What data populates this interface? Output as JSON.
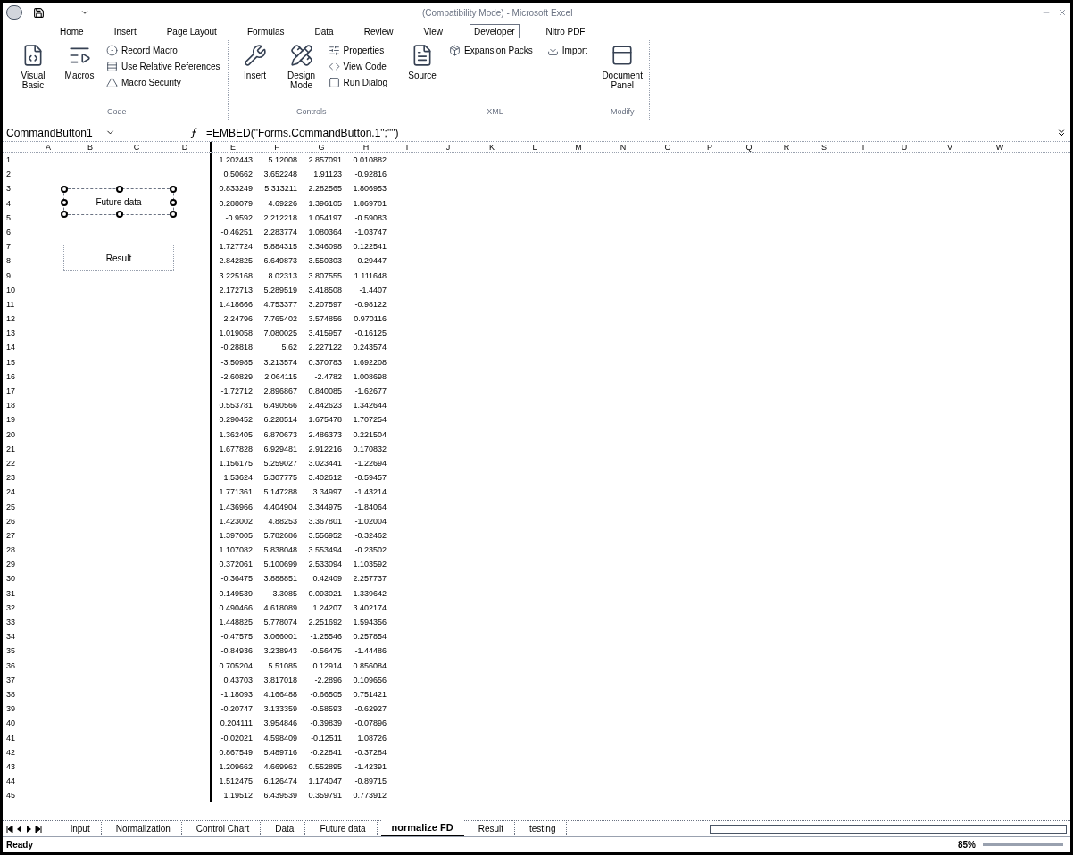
{
  "window": {
    "title": "(Compatibility Mode) - Microsoft Excel"
  },
  "ribbon_tabs": [
    {
      "label": "Home",
      "selected": false
    },
    {
      "label": "Insert",
      "selected": false
    },
    {
      "label": "Page Layout",
      "selected": false
    },
    {
      "label": "Formulas",
      "selected": false
    },
    {
      "label": "Data",
      "selected": false
    },
    {
      "label": "Review",
      "selected": false
    },
    {
      "label": "View",
      "selected": false
    },
    {
      "label": "Developer",
      "selected": true
    },
    {
      "label": "Nitro PDF",
      "selected": false
    }
  ],
  "ribbon_groups": [
    {
      "label": "Code",
      "large": [
        {
          "label": "Visual Basic"
        },
        {
          "label": "Macros"
        }
      ],
      "small": [
        {
          "label": "Record Macro"
        },
        {
          "label": "Use Relative References"
        },
        {
          "label": "Macro Security"
        }
      ]
    },
    {
      "label": "Controls",
      "large": [
        {
          "label": "Insert"
        },
        {
          "label": "Design Mode"
        }
      ],
      "small": [
        {
          "label": "Properties"
        },
        {
          "label": "View Code"
        },
        {
          "label": "Run Dialog"
        }
      ]
    },
    {
      "label": "XML",
      "large": [
        {
          "label": "Source"
        }
      ],
      "small": [
        {
          "label": "Expansion Packs"
        }
      ],
      "small2": [
        {
          "label": "Import"
        }
      ]
    },
    {
      "label": "Modify",
      "large": [
        {
          "label": "Document Panel"
        }
      ]
    }
  ],
  "name_box": "CommandButton1",
  "formula": "=EMBED(\"Forms.CommandButton.1\";\"\")",
  "columns": [
    "A",
    "B",
    "C",
    "D",
    "E",
    "F",
    "G",
    "H",
    "I",
    "J",
    "K",
    "L",
    "M",
    "N",
    "O",
    "P",
    "Q",
    "R",
    "S",
    "T",
    "U",
    "V",
    "W"
  ],
  "rows": [
    {
      "header": "1",
      "cells": [
        "1.202443",
        "5.12008",
        "2.857091",
        "0.010882"
      ]
    },
    {
      "header": "2",
      "cells": [
        "0.50662",
        "3.652248",
        "1.91123",
        "-0.92816"
      ]
    },
    {
      "header": "3",
      "cells": [
        "0.833249",
        "5.313211",
        "2.282565",
        "1.806953"
      ]
    },
    {
      "header": "4",
      "cells": [
        "0.288079",
        "4.69226",
        "1.396105",
        "1.869701"
      ]
    },
    {
      "header": "5",
      "cells": [
        "-0.9592",
        "2.212218",
        "1.054197",
        "-0.59083"
      ]
    },
    {
      "header": "6",
      "cells": [
        "-0.46251",
        "2.283774",
        "1.080364",
        "-1.03747"
      ]
    },
    {
      "header": "7",
      "cells": [
        "1.727724",
        "5.884315",
        "3.346098",
        "0.122541"
      ]
    },
    {
      "header": "8",
      "cells": [
        "2.842825",
        "6.649873",
        "3.550303",
        "-0.29447"
      ]
    },
    {
      "header": "9",
      "cells": [
        "3.225168",
        "8.02313",
        "3.807555",
        "1.111648"
      ]
    },
    {
      "header": "10",
      "cells": [
        "2.172713",
        "5.289519",
        "3.418508",
        "-1.4407"
      ]
    },
    {
      "header": "11",
      "cells": [
        "1.418666",
        "4.753377",
        "3.207597",
        "-0.98122"
      ]
    },
    {
      "header": "12",
      "cells": [
        "2.24796",
        "7.765402",
        "3.574856",
        "0.970116"
      ]
    },
    {
      "header": "13",
      "cells": [
        "1.019058",
        "7.080025",
        "3.415957",
        "-0.16125"
      ]
    },
    {
      "header": "14",
      "cells": [
        "-0.28818",
        "5.62",
        "2.227122",
        "0.243574"
      ]
    },
    {
      "header": "15",
      "cells": [
        "-3.50985",
        "3.213574",
        "0.370783",
        "1.692208"
      ]
    },
    {
      "header": "16",
      "cells": [
        "-2.60829",
        "2.064115",
        "-2.4782",
        "1.008698"
      ]
    },
    {
      "header": "17",
      "cells": [
        "-1.72712",
        "2.896867",
        "0.840085",
        "-1.62677"
      ]
    },
    {
      "header": "18",
      "cells": [
        "0.553781",
        "6.490566",
        "2.442623",
        "1.342644"
      ]
    },
    {
      "header": "19",
      "cells": [
        "0.290452",
        "6.228514",
        "1.675478",
        "1.707254"
      ]
    },
    {
      "header": "20",
      "cells": [
        "1.362405",
        "6.870673",
        "2.486373",
        "0.221504"
      ]
    },
    {
      "header": "21",
      "cells": [
        "1.677828",
        "6.929481",
        "2.912216",
        "0.170832"
      ]
    },
    {
      "header": "22",
      "cells": [
        "1.156175",
        "5.259027",
        "3.023441",
        "-1.22694"
      ]
    },
    {
      "header": "23",
      "cells": [
        "1.53624",
        "5.307775",
        "3.402612",
        "-0.59457"
      ]
    },
    {
      "header": "24",
      "cells": [
        "1.771361",
        "5.147288",
        "3.34997",
        "-1.43214"
      ]
    },
    {
      "header": "25",
      "cells": [
        "1.436966",
        "4.404904",
        "3.344975",
        "-1.84064"
      ]
    },
    {
      "header": "26",
      "cells": [
        "1.423002",
        "4.88253",
        "3.367801",
        "-1.02004"
      ]
    },
    {
      "header": "27",
      "cells": [
        "1.397005",
        "5.782686",
        "3.556952",
        "-0.32462"
      ]
    },
    {
      "header": "28",
      "cells": [
        "1.107082",
        "5.838048",
        "3.553494",
        "-0.23502"
      ]
    },
    {
      "header": "29",
      "cells": [
        "0.372061",
        "5.100699",
        "2.533094",
        "1.103592"
      ]
    },
    {
      "header": "30",
      "cells": [
        "-0.36475",
        "3.888851",
        "0.42409",
        "2.257737"
      ]
    },
    {
      "header": "31",
      "cells": [
        "0.149539",
        "3.3085",
        "0.093021",
        "1.339642"
      ]
    },
    {
      "header": "32",
      "cells": [
        "0.490466",
        "4.618089",
        "1.24207",
        "3.402174"
      ]
    },
    {
      "header": "33",
      "cells": [
        "1.448825",
        "5.778074",
        "2.251692",
        "1.594356"
      ]
    },
    {
      "header": "34",
      "cells": [
        "-0.47575",
        "3.066001",
        "-1.25546",
        "0.257854"
      ]
    },
    {
      "header": "35",
      "cells": [
        "-0.84936",
        "3.238943",
        "-0.56475",
        "-1.44486"
      ]
    },
    {
      "header": "36",
      "cells": [
        "0.705204",
        "5.51085",
        "0.12914",
        "0.856084"
      ]
    },
    {
      "header": "37",
      "cells": [
        "0.43703",
        "3.817018",
        "-2.2896",
        "0.109656"
      ]
    },
    {
      "header": "38",
      "cells": [
        "-1.18093",
        "4.166488",
        "-0.66505",
        "0.751421"
      ]
    },
    {
      "header": "39",
      "cells": [
        "-0.20747",
        "3.133359",
        "-0.58593",
        "-0.62927"
      ]
    },
    {
      "header": "40",
      "cells": [
        "0.204111",
        "3.954846",
        "-0.39839",
        "-0.07896"
      ]
    },
    {
      "header": "41",
      "cells": [
        "-0.02021",
        "4.598409",
        "-0.12511",
        "1.08726"
      ]
    },
    {
      "header": "42",
      "cells": [
        "0.867549",
        "5.489716",
        "-0.22841",
        "-0.37284"
      ]
    },
    {
      "header": "43",
      "cells": [
        "1.209662",
        "4.669962",
        "0.552895",
        "-1.42391"
      ]
    },
    {
      "header": "44",
      "cells": [
        "1.512475",
        "6.126474",
        "1.174047",
        "-0.89715"
      ]
    },
    {
      "header": "45",
      "cells": [
        "1.19512",
        "6.439539",
        "0.359791",
        "0.773912"
      ]
    }
  ],
  "sheet_buttons": [
    {
      "label": "Future data",
      "selected": true
    },
    {
      "label": "Result",
      "selected": false
    }
  ],
  "sheet_tabs": [
    {
      "label": "input",
      "selected": false
    },
    {
      "label": "Normalization",
      "selected": false
    },
    {
      "label": "Control Chart",
      "selected": false
    },
    {
      "label": "Data",
      "selected": false
    },
    {
      "label": "Future data",
      "selected": false
    },
    {
      "label": "normalize FD",
      "selected": true
    },
    {
      "label": "Result",
      "selected": false
    },
    {
      "label": "testing",
      "selected": false
    }
  ],
  "status_bar": {
    "mode": "Ready",
    "zoom": "85%"
  }
}
